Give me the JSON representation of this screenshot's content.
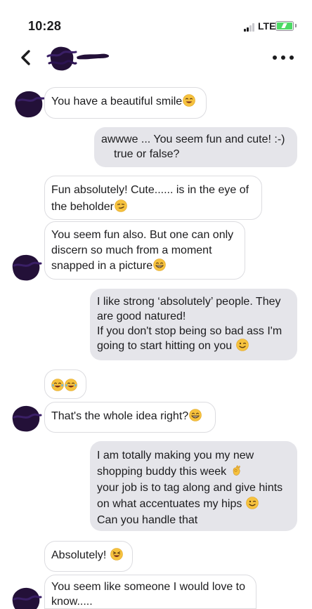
{
  "status_bar": {
    "time": "10:28",
    "network": "LTE",
    "battery_level": 1.0,
    "battery_charging": true,
    "signal_bars": 2,
    "signal_total_bars": 4
  },
  "nav": {
    "back_icon": "chevron-left-icon",
    "more_icon": "ellipsis-icon",
    "contact_name": ""
  },
  "colors": {
    "incoming_bubble": "#ffffff",
    "incoming_border": "#dcdce0",
    "outgoing_bubble": "#e5e5ea",
    "avatar_scribble": "#231038",
    "battery": "#4cd964",
    "emoji_face": "#f6c23e"
  },
  "messages": [
    {
      "side": "incoming",
      "lines": [
        "You have a beautiful smile"
      ],
      "emoji": "grinning-face-with-smiling-eyes-icon"
    },
    {
      "side": "outgoing",
      "lines": [
        "awwwe ... You seem fun and cute! :-)",
        "true or false?"
      ]
    },
    {
      "side": "incoming",
      "lines": [
        "Fun absolutely! Cute...... is in the eye of",
        "the beholder"
      ],
      "emoji": "smirking-face-icon"
    },
    {
      "side": "incoming",
      "lines": [
        "You seem fun also. But one can only",
        "discern so much from a moment",
        "snapped in a picture"
      ],
      "emoji": "grinning-face-icon"
    },
    {
      "side": "outgoing",
      "lines": [
        "I like strong ‘absolutely’ people. They",
        "are good natured!",
        "If you don't stop being so bad ass I'm",
        "going to start hitting on you"
      ],
      "emoji": "winking-face-icon"
    },
    {
      "side": "incoming",
      "lines": [
        ""
      ],
      "emoji": "tears-of-joy-icon"
    },
    {
      "side": "incoming",
      "lines": [
        "That's the whole idea right?"
      ],
      "emoji": "grinning-face-icon"
    },
    {
      "side": "outgoing",
      "lines": [
        "I am totally making you my new",
        "shopping buddy this week",
        "your job is to tag along and give hints",
        "on what accentuates my hips",
        "Can you handle that"
      ],
      "emoji": "ok-hand-icon"
    },
    {
      "side": "incoming",
      "lines": [
        "Absolutely!"
      ],
      "emoji": "laughing-face-icon"
    },
    {
      "side": "incoming",
      "lines": [
        "You seem like someone I would love to",
        "know....."
      ]
    }
  ]
}
